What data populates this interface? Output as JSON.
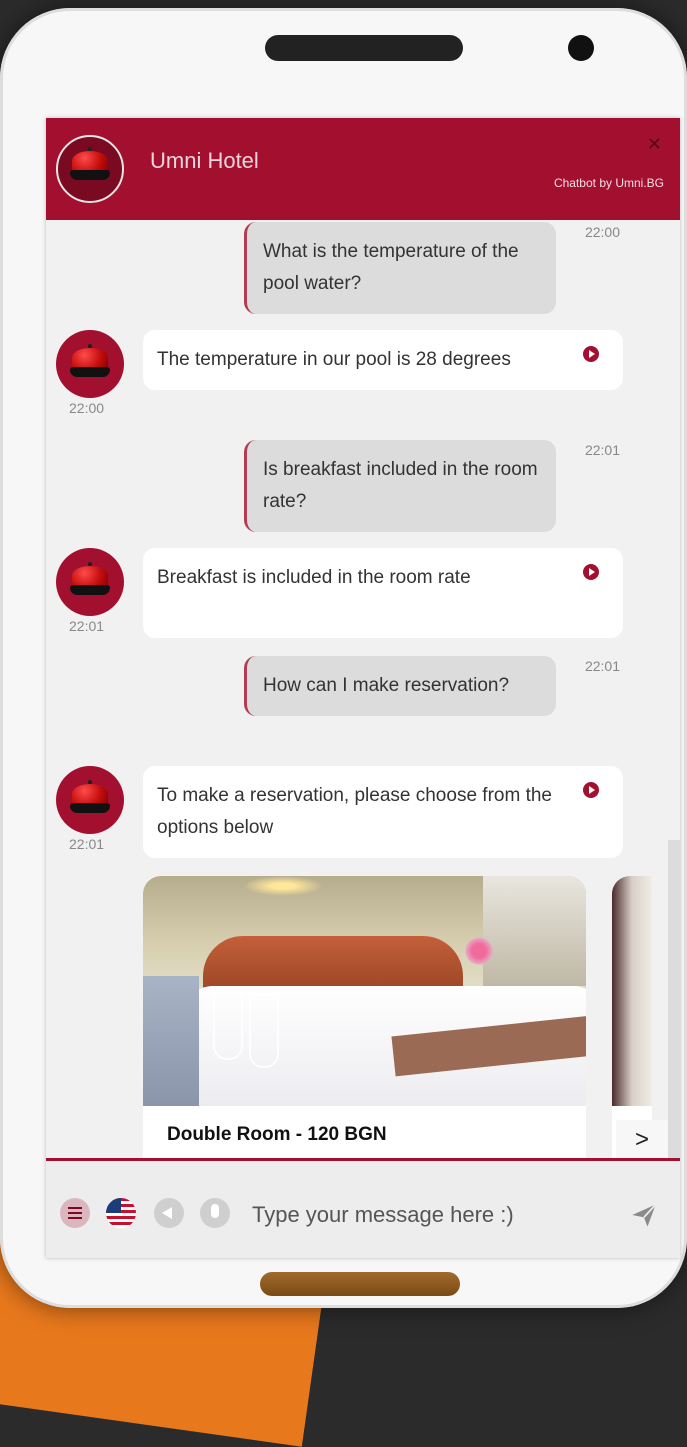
{
  "header": {
    "title": "Umni Hotel",
    "byline": "Chatbot by Umni.BG",
    "close_glyph": "✕"
  },
  "messages": [
    {
      "from": "user",
      "text": "What is the temperature of the pool water?",
      "time": "22:00"
    },
    {
      "from": "bot",
      "text": "The temperature in our pool is 28 degrees",
      "time": "22:00"
    },
    {
      "from": "user",
      "text": "Is breakfast included in the room rate?",
      "time": "22:01"
    },
    {
      "from": "bot",
      "text": "Breakfast is included in the room rate",
      "time": "22:01"
    },
    {
      "from": "user",
      "text": "How can I make reservation?",
      "time": "22:01"
    },
    {
      "from": "bot",
      "text": "To make a reservation, please choose from the options below",
      "time": "22:01"
    }
  ],
  "carousel": {
    "cards": [
      {
        "title": "Double Room - 120 BGN"
      }
    ],
    "next_glyph": ">"
  },
  "composer": {
    "placeholder": "Type your message here :)"
  },
  "icons": {
    "menu": "menu-icon",
    "language": "us-flag-icon",
    "sound": "speaker-icon",
    "mic": "microphone-icon",
    "send": "send-icon",
    "play": "play-icon",
    "avatar": "bell-icon"
  },
  "colors": {
    "brand": "#a3102f",
    "user_bubble": "#dcdcdc",
    "bot_bubble": "#ffffff"
  }
}
